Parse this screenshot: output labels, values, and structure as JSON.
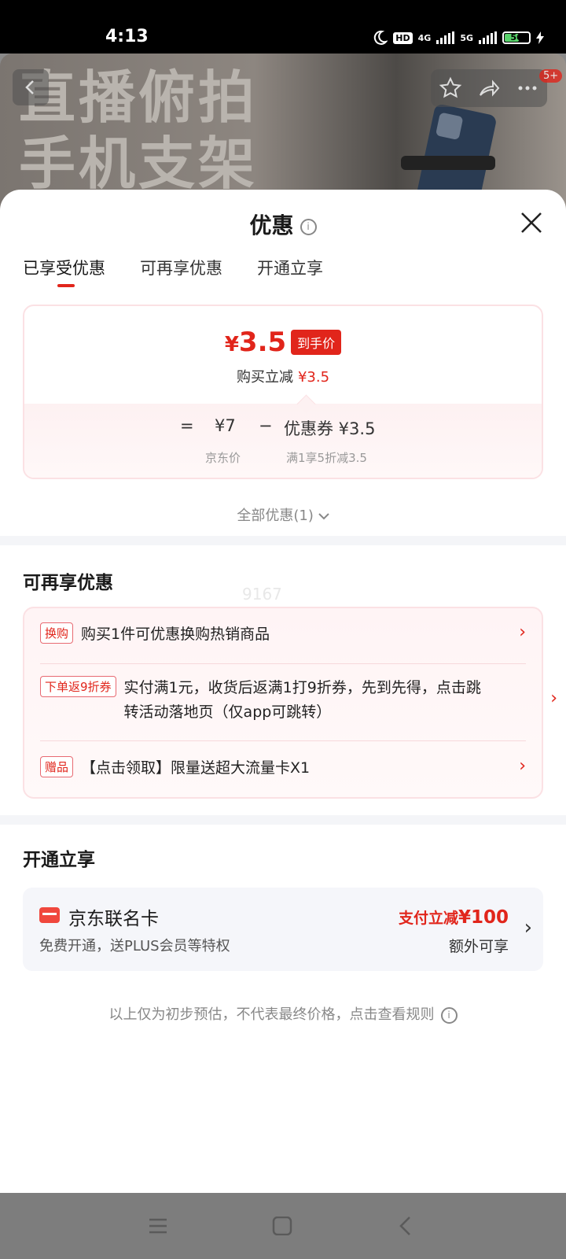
{
  "status": {
    "time": "4:13",
    "hd": "HD",
    "net1": "4G",
    "net2": "5G",
    "battery": "56"
  },
  "hero": {
    "line1": "直播俯拍",
    "line2": "手机支架",
    "cart_badge": "5+"
  },
  "sheet": {
    "title": "优惠",
    "tabs": [
      "已享受优惠",
      "可再享优惠",
      "开通立享"
    ],
    "price": {
      "currency": "¥",
      "amount": "3.5",
      "tag": "到手价",
      "sub_label": "购买立减",
      "sub_value": "¥3.5",
      "eq": "=",
      "base": "¥7",
      "minus": "−",
      "coupon": "优惠券 ¥3.5",
      "base_note": "京东价",
      "coupon_note": "满1享5折减3.5"
    },
    "all_offers": "全部优惠(1)",
    "watermark": "9167",
    "more_title": "可再享优惠",
    "offers": [
      {
        "tag": "换购",
        "text": "购买1件可优惠换购热销商品"
      },
      {
        "tag": "下单返9折券",
        "text": "实付满1元，收货后返满1打9折券，先到先得，点击跳转活动落地页（仅app可跳转）"
      },
      {
        "tag": "赠品",
        "text": "【点击领取】限量送超大流量卡X1"
      }
    ],
    "open_title": "开通立享",
    "card": {
      "name": "京东联名卡",
      "desc": "免费开通，送PLUS会员等特权",
      "pay_prefix": "支付立减",
      "pay_amount": "¥100",
      "extra": "额外可享"
    },
    "disclaimer": "以上仅为初步预估，不代表最终价格，点击查看规则"
  },
  "colors": {
    "accent": "#e1251b",
    "divider": "#f4f5f8"
  }
}
